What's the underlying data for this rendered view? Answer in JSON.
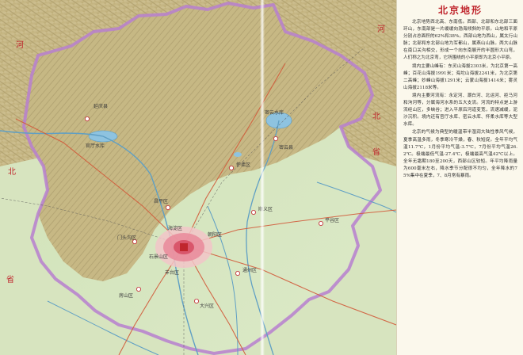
{
  "map": {
    "province_labels": [
      {
        "id": "hebei-left",
        "text": "河"
      },
      {
        "id": "hebei-right",
        "text": "河"
      },
      {
        "id": "bei-left",
        "text": "北"
      },
      {
        "id": "bei-right",
        "text": "北"
      },
      {
        "id": "sheng-left",
        "text": "省"
      },
      {
        "id": "sheng-right",
        "text": "省"
      }
    ],
    "place_labels": [
      {
        "id": "huairou",
        "text": "怀柔区"
      },
      {
        "id": "changping",
        "text": "昌平区"
      },
      {
        "id": "shunyi",
        "text": "顺义区"
      },
      {
        "id": "pinggu",
        "text": "平谷区"
      },
      {
        "id": "haidian",
        "text": "海淀区"
      },
      {
        "id": "chaoyang",
        "text": "朝阳区"
      },
      {
        "id": "mentougou",
        "text": "门头沟区"
      },
      {
        "id": "shijingshan",
        "text": "石景山区"
      },
      {
        "id": "fengtai",
        "text": "丰台区"
      },
      {
        "id": "tongzhou",
        "text": "通州区"
      },
      {
        "id": "fangshan",
        "text": "房山区"
      },
      {
        "id": "daxing",
        "text": "大兴区"
      },
      {
        "id": "yanqing",
        "text": "延庆县"
      },
      {
        "id": "miyun",
        "text": "密云县"
      },
      {
        "id": "guanting",
        "text": "官厅水库"
      },
      {
        "id": "miyun-res",
        "text": "密云水库"
      }
    ]
  },
  "panel": {
    "title": "北京地形",
    "paragraphs": [
      "北京地势西北高、东南低。西部、北部和东北部三面环山，东南部是一片缓缓向渤海倾斜的平原。山地和平原分别占总面积的62%和38%。西部山地为西山，属太行山脉；北部和东北部山地为军都山，属燕山山脉。两大山脉在南口关沟相交，形成一个向东南展开的半圆形大山弯，人们称之为北京弯，它所围绕的小平原即为北京小平原。",
      "境内主要山峰有：东灵山海拔2303米，为北京第一高峰；百花山海拔1991米；海坨山海拔2241米，为北京第二高峰；妙峰山海拔1291米；云蒙山海拔1414米；雾灵山海拔2118米等。",
      "境内主要河流有：永定河、潮白河、北运河、拒马河和泃河等，分属海河水系的五大支流。河流的特点是上游流经山区，多峡谷；进入平原后河道变宽，流速减缓，泥沙沉积。境内还有官厅水库、密云水库、怀柔水库等大型水库。",
      "北京的气候为典型的暖温带半湿润大陆性季风气候，夏季高温多雨，冬季寒冷干燥，春、秋短促。全年平均气温11.7℃，1月份平均气温-3.7℃，7月份平均气温26.2℃。极端最低气温-27.4℃，极端最高气温42℃以上。全年无霜期180至200天，西部山区较短。年平均降雨量为600毫米左右，降水季节分配很不均匀，全年降水的75%集中在夏季，7、8月常有暴雨。"
    ]
  },
  "colors": {
    "plain": "#d8e6c2",
    "mountain": "#c8b88a",
    "boundary": "#b480c8",
    "water": "#8ec3e0",
    "urban": "#e98a9a",
    "title_red": "#c0262d"
  }
}
